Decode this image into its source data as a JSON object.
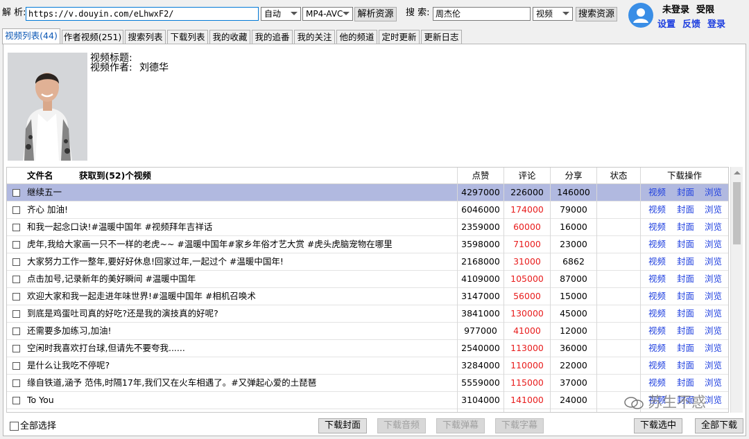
{
  "toolbar": {
    "parse_label": "解 析:",
    "url_value": "https://v.douyin.com/eLhwxF2/",
    "mode_value": "自动",
    "format_value": "MP4-AVC",
    "parse_button": "解析资源",
    "search_label": "搜 索:",
    "search_value": "周杰伦",
    "search_type_value": "视频",
    "search_button": "搜索资源"
  },
  "account": {
    "status": "未登录",
    "permission": "受限",
    "settings_link": "设置",
    "feedback_link": "反馈",
    "login_link": "登录",
    "avatar_color": "#3a8ee6"
  },
  "tabs": [
    "视频列表(44)",
    "作者视频(251)",
    "搜索列表",
    "下载列表",
    "我的收藏",
    "我的追番",
    "我的关注",
    "他的频道",
    "定时更新",
    "更新日志"
  ],
  "preview": {
    "title_label": "视频标题:",
    "author_label": "视频作者:",
    "author_value": "刘德华"
  },
  "table": {
    "columns": {
      "file_name": "文件名",
      "count": "获取到(52)个视频",
      "likes": "点赞",
      "comments": "评论",
      "shares": "分享",
      "status": "状态",
      "actions": "下载操作"
    },
    "action_labels": [
      "视频",
      "封面",
      "浏览"
    ],
    "rows": [
      {
        "title": "继续五一",
        "likes": "4297000",
        "comments": "226000",
        "shares": "146000",
        "red": false,
        "selected": true
      },
      {
        "title": "齐心 加油!",
        "likes": "6046000",
        "comments": "174000",
        "shares": "79000",
        "red": true
      },
      {
        "title": "和我一起念口诀!#温暖中国年 #视频拜年吉祥话",
        "likes": "2359000",
        "comments": "60000",
        "shares": "16000",
        "red": true
      },
      {
        "title": "虎年,我给大家画一只不一样的老虎~~ #温暖中国年#家乡年俗才艺大赏 #虎头虎脑宠物在哪里",
        "likes": "3598000",
        "comments": "71000",
        "shares": "23000",
        "red": true
      },
      {
        "title": "大家努力工作一整年,要好好休息!回家过年,一起过个 #温暖中国年!",
        "likes": "2168000",
        "comments": "31000",
        "shares": "6862",
        "red": true
      },
      {
        "title": "点击加号,记录新年的美好瞬间 #温暖中国年",
        "likes": "4109000",
        "comments": "105000",
        "shares": "87000",
        "red": true
      },
      {
        "title": "欢迎大家和我一起走进年味世界!#温暖中国年 #相机召唤术",
        "likes": "3147000",
        "comments": "56000",
        "shares": "15000",
        "red": true
      },
      {
        "title": "到底是鸡蛋吐司真的好吃?还是我的演技真的好呢?",
        "likes": "3841000",
        "comments": "130000",
        "shares": "45000",
        "red": true
      },
      {
        "title": "还需要多加练习,加油!",
        "likes": "977000",
        "comments": "41000",
        "shares": "12000",
        "red": true
      },
      {
        "title": "空闲时我喜欢打台球,但请先不要夸我......",
        "likes": "2540000",
        "comments": "113000",
        "shares": "36000",
        "red": true
      },
      {
        "title": "是什么让我吃不停呢?",
        "likes": "3284000",
        "comments": "110000",
        "shares": "22000",
        "red": true
      },
      {
        "title": "缘自铁道,涵予 范伟,时隔17年,我们又在火车相遇了。#又弹起心爱的土琵琶",
        "likes": "5559000",
        "comments": "115000",
        "shares": "37000",
        "red": true
      },
      {
        "title": "To You",
        "likes": "3104000",
        "comments": "141000",
        "shares": "24000",
        "red": true
      }
    ]
  },
  "footer": {
    "select_all": "全部选择",
    "download_cover": "下载封面",
    "download_audio": "下载音频",
    "download_danmaku": "下载弹幕",
    "download_subtitle": "下载字幕",
    "download_selected": "下载选中",
    "download_all": "全部下载"
  },
  "watermark": "苏生不惑"
}
